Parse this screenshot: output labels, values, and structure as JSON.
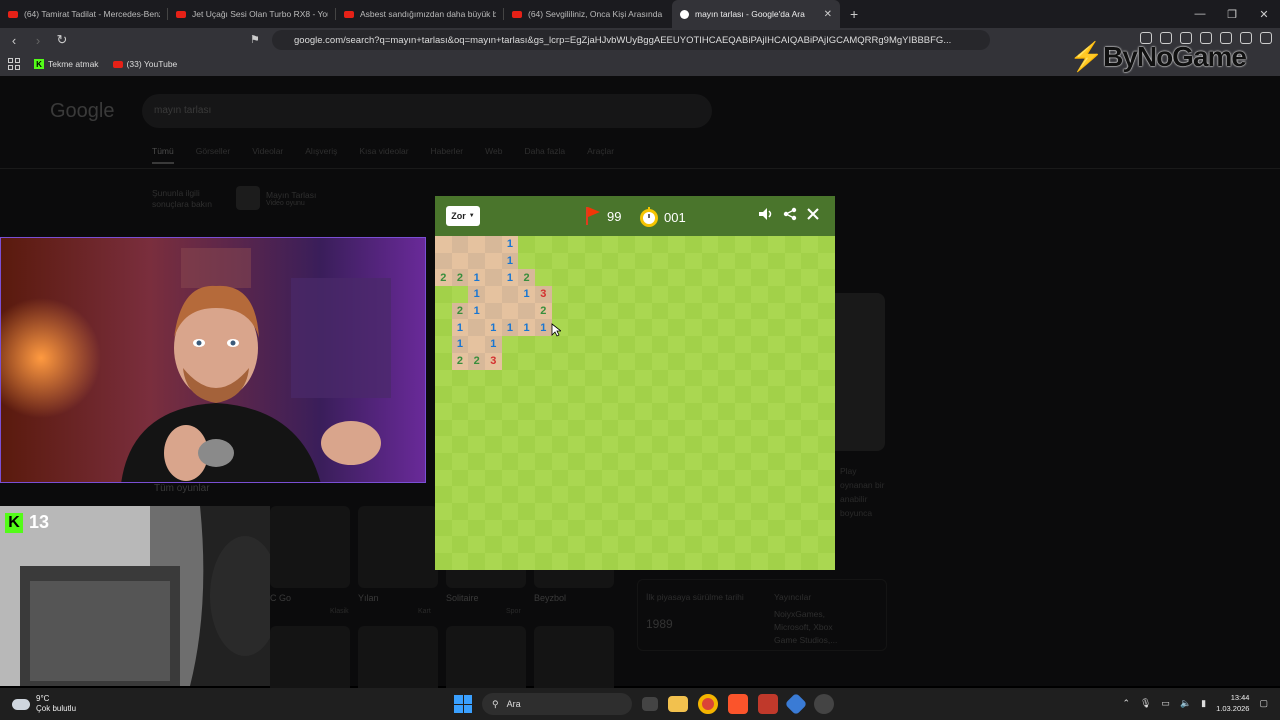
{
  "browser": {
    "tabs": [
      {
        "title": "(64) Tamirat Tadilat - Mercedes-Benz",
        "icon": "youtube-icon"
      },
      {
        "title": "Jet Uçağı Sesi Olan Turbo RX8 - YouT",
        "icon": "youtube-icon"
      },
      {
        "title": "Asbest sandığımızdan daha büyük bi",
        "icon": "youtube-icon"
      },
      {
        "title": "(64) Sevgililiniz, Onca Kişi Arasında",
        "icon": "youtube-icon"
      },
      {
        "title": "mayın tarlası - Google'da Ara",
        "icon": "google-icon",
        "active": true
      }
    ],
    "new_tab": "+",
    "url": "google.com/search?q=mayın+tarlası&oq=mayın+tarlası&gs_lcrp=EgZjaHJvbWUyBggAEEUYOTIHCAEQABiPAjIHCAIQABiPAjIGCAMQRRg9MgYIBBBFG...",
    "bookmarks": [
      {
        "label": "Tekme atmak",
        "icon": "kick-icon"
      },
      {
        "label": "(33) YouTube",
        "icon": "youtube-icon"
      }
    ],
    "watermark": "ByNoGame"
  },
  "google": {
    "logo": "Google",
    "search_value": "mayın tarlası",
    "tabs": [
      "Tümü",
      "Görseller",
      "Videolar",
      "Alışveriş",
      "Kısa videolar",
      "Haberler",
      "Web",
      "Daha fazla",
      "Araçlar"
    ],
    "related_text": "Şununla ilgili sonuçlara bakın",
    "related_item": "Mayın Tarlası",
    "related_sub": "Video oyunu",
    "all_games": "Tüm oyunlar",
    "games": [
      "C Go",
      "Yılan",
      "Solitaire",
      "Beyzbol"
    ],
    "games_sub": [
      "Klasik",
      "Kart",
      "Spor"
    ],
    "play_link": "Play",
    "side_text": [
      "oynanan bir",
      "anabilir",
      "boyunca"
    ],
    "release_label": "İlk piyasaya sürülme tarihi",
    "release_year": "1989",
    "publishers_label": "Yayıncılar",
    "publishers": "NoiyxGames, Microsoft, Xbox Game Studios,..."
  },
  "minesweeper": {
    "difficulty": "Zor",
    "flags": "99",
    "timer": "001",
    "colors": {
      "header": "#4a752c",
      "light": "#aad751",
      "dark": "#a2d149",
      "revealed_light": "#e5c29f",
      "revealed_dark": "#d7b899"
    },
    "rows": 20,
    "cols": 24,
    "revealed": [
      [
        0,
        0,
        ""
      ],
      [
        0,
        1,
        ""
      ],
      [
        0,
        2,
        ""
      ],
      [
        0,
        3,
        ""
      ],
      [
        0,
        4,
        "1"
      ],
      [
        1,
        0,
        ""
      ],
      [
        1,
        1,
        ""
      ],
      [
        1,
        2,
        ""
      ],
      [
        1,
        3,
        ""
      ],
      [
        1,
        4,
        "1"
      ],
      [
        2,
        0,
        "2"
      ],
      [
        2,
        1,
        "2"
      ],
      [
        2,
        2,
        "1"
      ],
      [
        2,
        3,
        ""
      ],
      [
        2,
        4,
        "1"
      ],
      [
        2,
        5,
        "2"
      ],
      [
        3,
        2,
        "1"
      ],
      [
        3,
        3,
        ""
      ],
      [
        3,
        4,
        ""
      ],
      [
        3,
        5,
        "1"
      ],
      [
        3,
        6,
        "3"
      ],
      [
        4,
        1,
        "2"
      ],
      [
        4,
        2,
        "1"
      ],
      [
        4,
        3,
        ""
      ],
      [
        4,
        4,
        ""
      ],
      [
        4,
        5,
        ""
      ],
      [
        4,
        6,
        "2"
      ],
      [
        5,
        1,
        "1"
      ],
      [
        5,
        2,
        ""
      ],
      [
        5,
        3,
        "1"
      ],
      [
        5,
        4,
        "1"
      ],
      [
        5,
        5,
        "1"
      ],
      [
        5,
        6,
        "1"
      ],
      [
        6,
        1,
        "1"
      ],
      [
        6,
        2,
        ""
      ],
      [
        6,
        3,
        "1"
      ],
      [
        7,
        1,
        "2"
      ],
      [
        7,
        2,
        "2"
      ],
      [
        7,
        3,
        "3"
      ]
    ]
  },
  "overlay": {
    "kick_count": "13"
  },
  "taskbar": {
    "temp": "9°C",
    "weather": "Çok bulutlu",
    "search": "Ara",
    "time": "13:44",
    "date": "1.03.2026"
  }
}
